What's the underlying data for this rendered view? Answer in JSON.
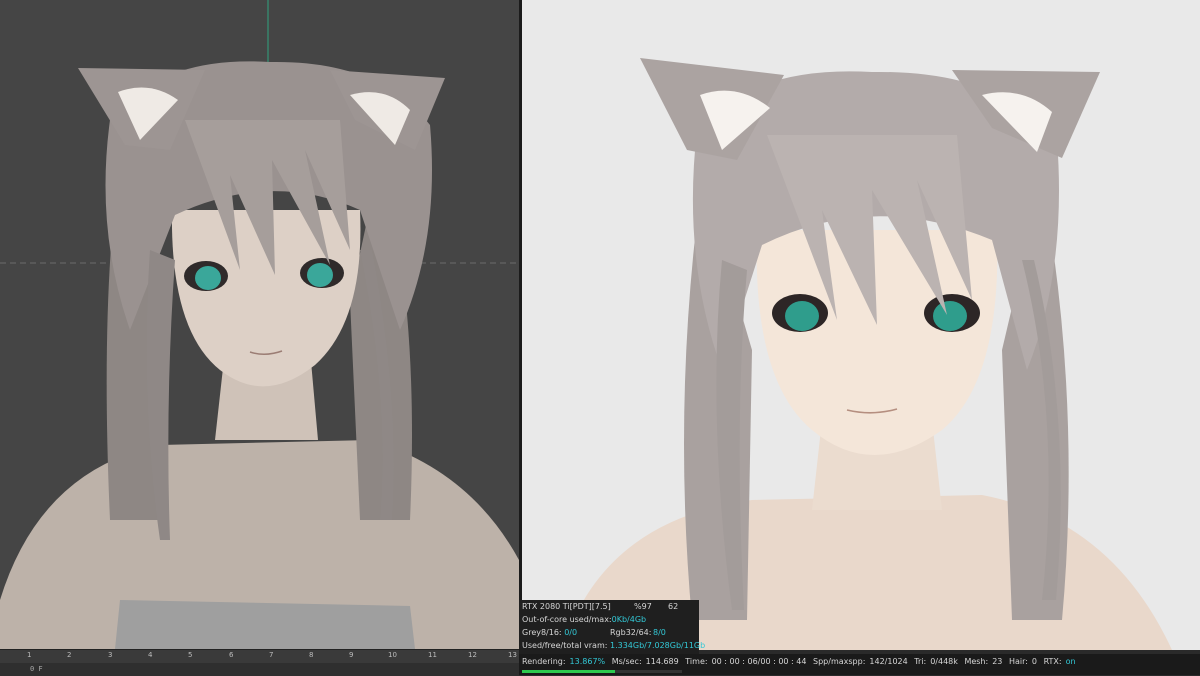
{
  "viewport": {
    "bg_color": "#454545",
    "model_name": "cat-ear anime character"
  },
  "render": {
    "bg_color": "#e9e9e9"
  },
  "timeline": {
    "ticks": [
      "1",
      "2",
      "3",
      "4",
      "5",
      "6",
      "7",
      "8",
      "9",
      "10",
      "11",
      "12",
      "13"
    ],
    "frame_label": "0 F"
  },
  "stats": {
    "gpu": "RTX 2080 Ti[PDT][7.5]",
    "gpu_percent": "%97",
    "gpu_temp": "62",
    "out_of_core_label": "Out-of-core used/max:",
    "out_of_core_value": "0Kb/4Gb",
    "grey_label": "Grey8/16:",
    "grey_value": "0/0",
    "rgb_label": "Rgb32/64:",
    "rgb_value": "8/0",
    "vram_label": "Used/free/total vram:",
    "vram_value": "1.334Gb/7.028Gb/11Gb"
  },
  "status": {
    "rendering_label": "Rendering:",
    "rendering_value": "13.867%",
    "ms_label": "Ms/sec:",
    "ms_value": "114.689",
    "time_label": "Time:",
    "time_value": "00 : 00 : 06/00 : 00 : 44",
    "spp_label": "Spp/maxspp:",
    "spp_value": "142/1024",
    "tri_label": "Tri:",
    "tri_value": "0/448k",
    "mesh_label": "Mesh:",
    "mesh_value": "23",
    "hair_label": "Hair:",
    "hair_value": "0",
    "rtx_label": "RTX:",
    "rtx_value": "on",
    "progress_fraction": 0.13867,
    "progress_color": "#2ec94f",
    "accent_color": "#33c8d6"
  }
}
